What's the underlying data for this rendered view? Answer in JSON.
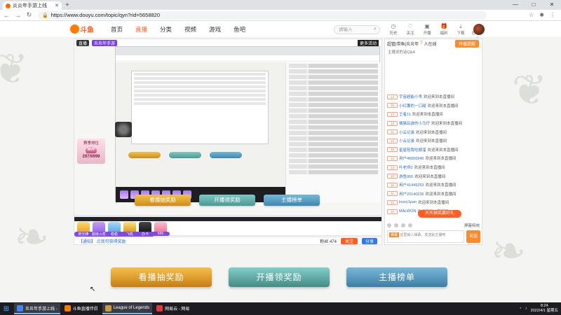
{
  "browser": {
    "tab_title": "炎炎年手游上线",
    "url": "https://www.douyu.com/topic/qyn?rid=5658820",
    "controls": [
      "—",
      "□",
      "✕"
    ]
  },
  "site": {
    "logo": "斗鱼",
    "nav": [
      "首页",
      "直播",
      "分类",
      "视频",
      "游戏",
      "鱼吧"
    ],
    "search_placeholder": "请输入",
    "tools": [
      "历史",
      "关注",
      "开播",
      "福利",
      "下载",
      "创作中心"
    ]
  },
  "player": {
    "badge": "直播",
    "tag": "炎炎年手游",
    "right_label": "更多活动",
    "buttons": [
      "看播抽奖励",
      "开播领奖励",
      "主播榜单"
    ],
    "mvp": {
      "label": "赛季排位",
      "value": "297/9999"
    }
  },
  "giftbar": {
    "gifts": [
      "荧光棒",
      "超级火箭",
      "稳稳",
      "飞机",
      "办卡",
      "666"
    ]
  },
  "info": {
    "notice": "【通知】 点我可获得奖励",
    "stats": "粉丝 474",
    "follow": "关注",
    "share": "分享"
  },
  "chat": {
    "title_prefix": "超管|带鱼|炎炎年",
    "title_count": "7",
    "title_suffix": "人在线",
    "open_button": "开播提醒",
    "sub": "主播说的话Q&A",
    "rows": [
      {
        "lvl": "12",
        "name": "宇宙超能小乖",
        "msg": "欢迎来到本直播间"
      },
      {
        "lvl": "15",
        "name": "小红薯的一口甜",
        "msg": "欢迎来到本直播间"
      },
      {
        "lvl": "14",
        "name": "王者11",
        "msg": "欢迎来到本直播间"
      },
      {
        "lvl": "13",
        "name": "橘猫玩游的小马仔",
        "msg": "欢迎来到本直播间"
      },
      {
        "lvl": "11",
        "name": "小云记录",
        "msg": "欢迎来到本直播间"
      },
      {
        "lvl": "12",
        "name": "小云记录",
        "msg": "欢迎来到本直播间"
      },
      {
        "lvl": "16",
        "name": "星星陪我吃顺溜",
        "msg": "欢迎来到本直播间"
      },
      {
        "lvl": "10",
        "name": "用户46650946",
        "msg": "欢迎来到本直播间"
      },
      {
        "lvl": "14",
        "name": "叶老师0",
        "msg": "欢迎来到本直播间"
      },
      {
        "lvl": "13",
        "name": "游鱼066",
        "msg": "欢迎来到本直播间"
      },
      {
        "lvl": "11",
        "name": "用户41449253",
        "msg": "欢迎来到本直播间"
      },
      {
        "lvl": "11",
        "name": "用户20140236",
        "msg": "欢迎来到本直播间"
      },
      {
        "lvl": "12",
        "name": "lovey1pan",
        "msg": "欢迎来到本直播间"
      },
      {
        "lvl": "10",
        "name": "MALWON",
        "msg": "欢迎来到本直播间"
      }
    ],
    "block_label": "屏蔽特效",
    "input_placeholder": "这里输入弹幕，发送给主播吧",
    "input_pill": "弹幕",
    "send": "发送",
    "float_button": "天天抽奖赢好礼"
  },
  "bottom_buttons": [
    "看播抽奖励",
    "开播领奖励",
    "主播榜单"
  ],
  "taskbar": {
    "items": [
      "炎炎年手游上线 -",
      "斗鱼直播伴侣",
      "League of Legends",
      "网易云 - 网易"
    ],
    "time": "8:24",
    "date": "2022/4/1 星期五"
  }
}
